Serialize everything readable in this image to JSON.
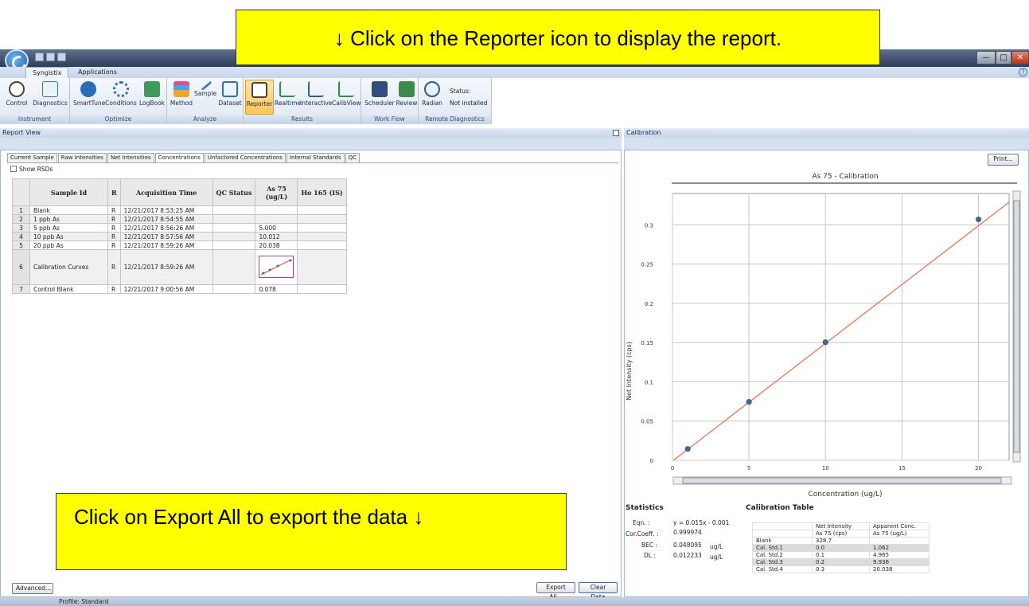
{
  "callouts": {
    "top": "↓ Click on the Reporter icon to display the report.",
    "bottom": "Click on Export All to export the data ↓"
  },
  "window": {
    "minimize_glyph": "—",
    "maximize_glyph": "□",
    "close_glyph": "✕",
    "help_glyph": "?"
  },
  "ribbon": {
    "tabs": [
      "Syngistix",
      "Applications"
    ],
    "groups": [
      {
        "label": "Instrument",
        "buttons": [
          "Control",
          "Diagnostics"
        ]
      },
      {
        "label": "Optimize",
        "buttons": [
          "SmartTune",
          "Conditions",
          "LogBook"
        ]
      },
      {
        "label": "Analyze",
        "buttons": [
          "Method",
          "Sample",
          "Dataset"
        ]
      },
      {
        "label": "Results",
        "buttons": [
          "Reporter",
          "Realtime",
          "Interactive",
          "CalibView"
        ]
      },
      {
        "label": "Work Flow",
        "buttons": [
          "Scheduler",
          "Review"
        ]
      },
      {
        "label": "Remote Diagnostics",
        "buttons": [
          "Radian"
        ]
      }
    ],
    "status_label": "Status:",
    "status_value": "Not installed"
  },
  "report_view": {
    "title": "Report View",
    "tabs": [
      "Current Sample",
      "Raw Intensities",
      "Net Intensities",
      "Concentrations",
      "Unfactored Concentrations",
      "Internal Standards",
      "QC"
    ],
    "active_tab": "Concentrations",
    "show_rsds_label": "Show RSDs",
    "columns": [
      "",
      "Sample Id",
      "R",
      "Acquisition Time",
      "QC Status",
      "As 75 (ug/L)",
      "Ho 165 (IS)"
    ],
    "rows": [
      {
        "n": "1",
        "id": "Blank",
        "r": "R",
        "time": "12/21/2017 8:53:25 AM",
        "qc": "",
        "as75": "",
        "ho165": ""
      },
      {
        "n": "2",
        "id": "1 ppb As",
        "r": "R",
        "time": "12/21/2017 8:54:55 AM",
        "qc": "",
        "as75": "",
        "ho165": ""
      },
      {
        "n": "3",
        "id": "5 ppb As",
        "r": "R",
        "time": "12/21/2017 8:56:26 AM",
        "qc": "",
        "as75": "5.000",
        "ho165": ""
      },
      {
        "n": "4",
        "id": "10 ppb As",
        "r": "R",
        "time": "12/21/2017 8:57:56 AM",
        "qc": "",
        "as75": "10.012",
        "ho165": ""
      },
      {
        "n": "5",
        "id": "20 ppb As",
        "r": "R",
        "time": "12/21/2017 8:59:26 AM",
        "qc": "",
        "as75": "20.038",
        "ho165": ""
      },
      {
        "n": "6",
        "id": "Calibration Curves",
        "r": "R",
        "time": "12/21/2017 8:59:26 AM",
        "qc": "",
        "as75": "",
        "ho165": ""
      },
      {
        "n": "7",
        "id": "Control Blank",
        "r": "R",
        "time": "12/21/2017 9:00:56 AM",
        "qc": "",
        "as75": "0.078",
        "ho165": ""
      }
    ],
    "advanced_button": "Advanced...",
    "export_button": "Export All...",
    "clear_button": "Clear Data"
  },
  "calibration": {
    "title": "Calibration",
    "print_button": "Print...",
    "statistics_title": "Statistics",
    "stats": [
      {
        "label": "Eqn. :",
        "value": "y = 0.015x - 0.001",
        "unit": ""
      },
      {
        "label": "Cor.Coeff. :",
        "value": "0.999974",
        "unit": ""
      },
      {
        "label": "BEC :",
        "value": "0.048095",
        "unit": "ug/L"
      },
      {
        "label": "DL :",
        "value": "0.012233",
        "unit": "ug/L"
      }
    ],
    "table_title": "Calibration Table",
    "table_headers": [
      [
        "",
        "Net Intensity",
        "Apparent Conc."
      ],
      [
        "",
        "As 75 (cps)",
        "As 75 (ug/L)"
      ]
    ],
    "table_rows": [
      [
        "Blank",
        "328.7",
        ""
      ],
      [
        "Cal. Std.1",
        "0.0",
        "1.062"
      ],
      [
        "Cal. Std.2",
        "0.1",
        "4.965"
      ],
      [
        "Cal. Std.3",
        "0.2",
        "9.936"
      ],
      [
        "Cal. Std.4",
        "0.3",
        "20.038"
      ]
    ]
  },
  "chart_data": {
    "type": "scatter",
    "title": "As 75 - Calibration",
    "xlabel": "Concentration (ug/L)",
    "ylabel": "Net Intensity (cps)",
    "xlim": [
      0,
      22
    ],
    "ylim": [
      0,
      0.34
    ],
    "x_ticks": [
      "0",
      "5",
      "10",
      "15",
      "20"
    ],
    "y_ticks": [
      "0",
      "0.05",
      "0.1",
      "0.15",
      "0.2",
      "0.25",
      "0.3"
    ],
    "grid": true,
    "points": [
      [
        1,
        0.0145
      ],
      [
        5,
        0.0745
      ],
      [
        10,
        0.1505
      ],
      [
        20,
        0.307
      ]
    ],
    "fit_line": [
      [
        0,
        -0.001
      ],
      [
        22,
        0.329
      ]
    ],
    "colors": {
      "line": "#e8735a",
      "point": "#3f6a94"
    }
  },
  "statusbar": {
    "profile": "Profile: Standard"
  },
  "colors": {
    "callout": "#ffff00",
    "ribbon_selected": "#ffc55a"
  }
}
